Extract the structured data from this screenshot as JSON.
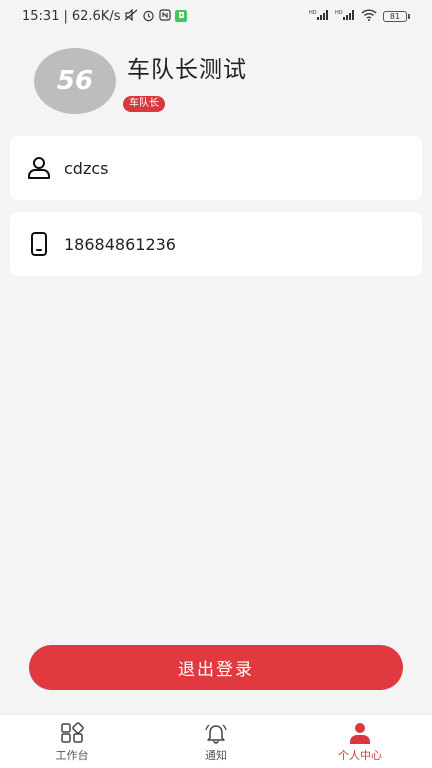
{
  "status_bar": {
    "time": "15:31",
    "network_speed": "62.6K/s",
    "battery": "81",
    "signal_label_1": "HD",
    "signal_label_2": "HD"
  },
  "profile": {
    "avatar_text": "56",
    "name": "车队长测试",
    "role_badge": "车队长"
  },
  "info_cards": {
    "username": "cdzcs",
    "phone": "18684861236"
  },
  "actions": {
    "logout_label": "退出登录"
  },
  "tab_bar": {
    "tabs": [
      {
        "label": "工作台",
        "icon": "grid-icon",
        "active": false
      },
      {
        "label": "通知",
        "icon": "bell-icon",
        "active": false
      },
      {
        "label": "个人中心",
        "icon": "person-icon",
        "active": true
      }
    ]
  },
  "colors": {
    "accent": "#e0393f",
    "avatar_bg": "#bdbdbd",
    "page_bg": "#f4f4f4"
  }
}
